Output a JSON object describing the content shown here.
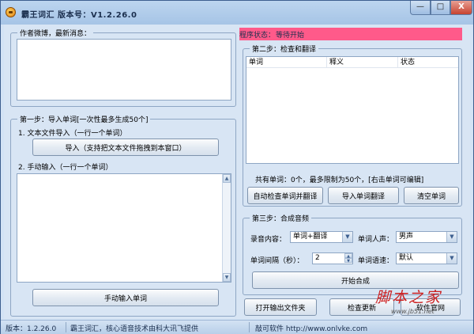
{
  "window": {
    "title": "霸王词汇   版本号：V1.2.26.0",
    "min": "—",
    "max": "□",
    "close": "X"
  },
  "news": {
    "legend": "作者微博，最新消息："
  },
  "status": {
    "label": "程序状态：",
    "value": "等待开始"
  },
  "step1": {
    "legend": "第一步：导入单词[一次性最多生成50个]",
    "file_import_label": "1. 文本文件导入（一行一个单词）",
    "import_button": "导入（支持把文本文件拖拽到本窗口）",
    "manual_label": "2. 手动输入（一行一个单词）",
    "manual_button": "手动输入单词"
  },
  "step2": {
    "legend": "第二步：检查和翻译",
    "columns": [
      "单词",
      "释义",
      "状态"
    ],
    "summary": "共有单词：0个，最多限制为50个，[右击单词可编辑]",
    "auto_check_button": "自动检查单词并翻译",
    "import_translate_button": "导入单词翻译",
    "clear_button": "清空单词"
  },
  "step3": {
    "legend": "第三步：合成音频",
    "content_label": "录音内容：",
    "content_value": "单词+翻译",
    "voice_label": "单词人声：",
    "voice_value": "男声",
    "interval_label": "单词间隔（秒）：",
    "interval_value": "2",
    "speed_label": "单词语速：",
    "speed_value": "默认",
    "start_button": "开始合成"
  },
  "bottom": {
    "open_folder_button": "打开输出文件夹",
    "check_update_button": "检查更新",
    "website_button": "软件官网"
  },
  "statusbar": {
    "version": "版本：1.2.26.0",
    "credit": "霸王词汇，核心语音技术由科大讯飞提供",
    "company": "敲可软件 http://www.onlvke.com"
  },
  "watermark": {
    "text": "脚本之家",
    "url": "www.jb51.net"
  },
  "colors": {
    "status_bar": "#ff5a8a",
    "window_frame": "#d3e3f5"
  }
}
